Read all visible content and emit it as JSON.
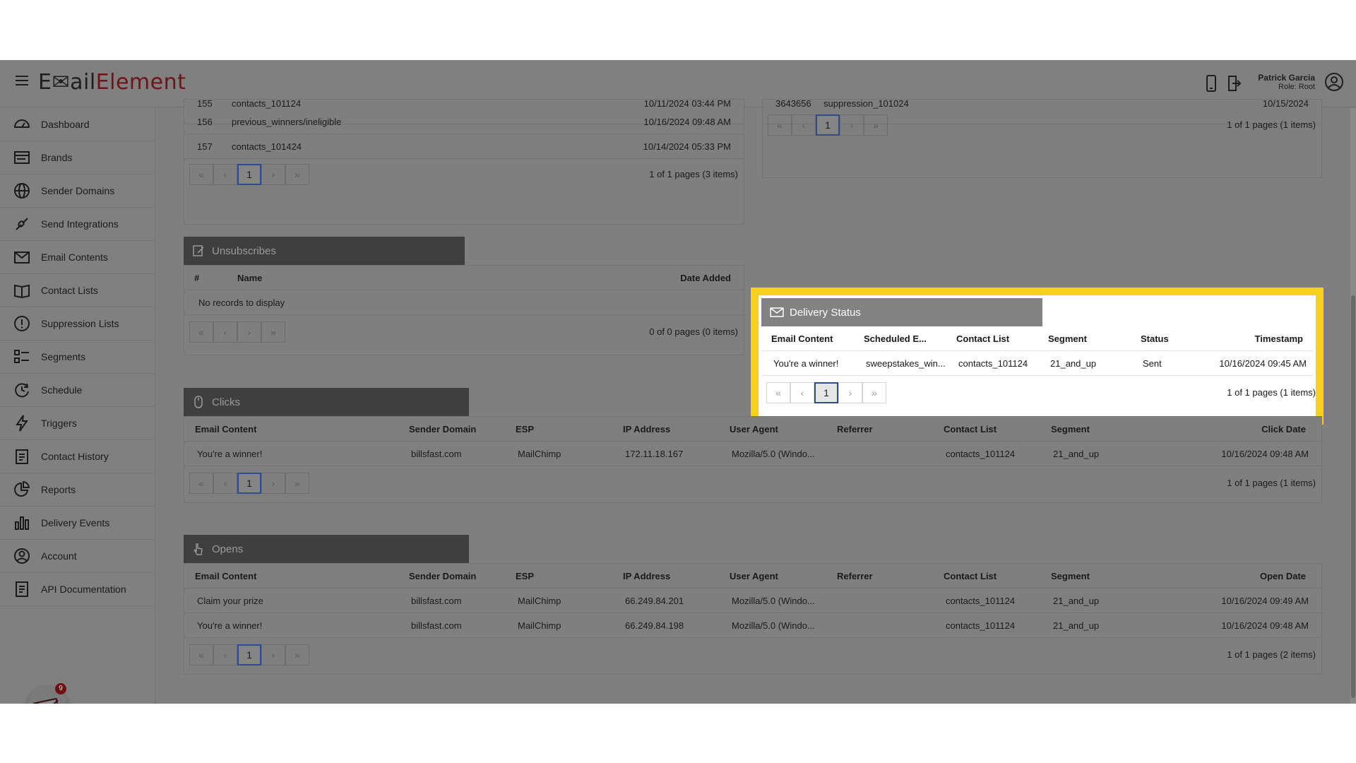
{
  "app": {
    "logo_e": "E",
    "logo_mail": "✉ail",
    "logo_element": "Element"
  },
  "user": {
    "name": "Patrick Garcia",
    "role": "Role: Root"
  },
  "sidebar": {
    "items": [
      {
        "label": "Dashboard",
        "icon": "dashboard-icon"
      },
      {
        "label": "Brands",
        "icon": "brands-icon"
      },
      {
        "label": "Sender Domains",
        "icon": "globe-icon"
      },
      {
        "label": "Send Integrations",
        "icon": "link-icon"
      },
      {
        "label": "Email Contents",
        "icon": "envelope-icon"
      },
      {
        "label": "Contact Lists",
        "icon": "book-icon"
      },
      {
        "label": "Suppression Lists",
        "icon": "alert-icon"
      },
      {
        "label": "Segments",
        "icon": "segments-icon"
      },
      {
        "label": "Schedule",
        "icon": "clock-icon"
      },
      {
        "label": "Triggers",
        "icon": "bolt-icon"
      },
      {
        "label": "Contact History",
        "icon": "clipboard-icon"
      },
      {
        "label": "Reports",
        "icon": "pie-icon"
      },
      {
        "label": "Delivery Events",
        "icon": "bar-chart-icon"
      },
      {
        "label": "Account",
        "icon": "user-icon"
      },
      {
        "label": "API Documentation",
        "icon": "document-icon"
      }
    ],
    "notification_count": "9"
  },
  "contact_lists_partial": {
    "rows": [
      {
        "id": "155",
        "name": "contacts_101124",
        "date": "10/11/2024 03:44 PM"
      },
      {
        "id": "156",
        "name": "previous_winners/ineligible",
        "date": "10/16/2024 09:48 AM"
      },
      {
        "id": "157",
        "name": "contacts_101424",
        "date": "10/14/2024 05:33 PM"
      }
    ],
    "page": "1",
    "info": "1 of 1 pages (3 items)"
  },
  "suppression_partial": {
    "row": {
      "id": "3643656",
      "name": "suppression_101024",
      "date": "10/15/2024"
    },
    "page": "1",
    "info": "1 of 1 pages (1 items)"
  },
  "unsubscribes": {
    "title": "Unsubscribes",
    "headers": {
      "num": "#",
      "name": "Name",
      "date": "Date Added"
    },
    "empty": "No records to display",
    "page": "",
    "info": "0 of 0 pages (0 items)"
  },
  "delivery_status": {
    "title": "Delivery Status",
    "headers": {
      "email": "Email Content",
      "scheduled": "Scheduled E...",
      "list": "Contact List",
      "segment": "Segment",
      "status": "Status",
      "timestamp": "Timestamp"
    },
    "row": {
      "email": "You're a winner!",
      "scheduled": "sweepstakes_win...",
      "list": "contacts_101124",
      "segment": "21_and_up",
      "status": "Sent",
      "timestamp": "10/16/2024 09:45 AM"
    },
    "page": "1",
    "info": "1 of 1 pages (1 items)"
  },
  "clicks": {
    "title": "Clicks",
    "headers": {
      "email": "Email Content",
      "domain": "Sender Domain",
      "esp": "ESP",
      "ip": "IP Address",
      "agent": "User Agent",
      "ref": "Referrer",
      "list": "Contact List",
      "segment": "Segment",
      "date": "Click Date"
    },
    "rows": [
      {
        "email": "You're a winner!",
        "domain": "billsfast.com",
        "esp": "MailChimp",
        "ip": "172.11.18.167",
        "agent": "Mozilla/5.0 (Windo...",
        "ref": "",
        "list": "contacts_101124",
        "segment": "21_and_up",
        "date": "10/16/2024 09:48 AM"
      }
    ],
    "page": "1",
    "info": "1 of 1 pages (1 items)"
  },
  "opens": {
    "title": "Opens",
    "headers": {
      "email": "Email Content",
      "domain": "Sender Domain",
      "esp": "ESP",
      "ip": "IP Address",
      "agent": "User Agent",
      "ref": "Referrer",
      "list": "Contact List",
      "segment": "Segment",
      "date": "Open Date"
    },
    "rows": [
      {
        "email": "Claim your prize",
        "domain": "billsfast.com",
        "esp": "MailChimp",
        "ip": "66.249.84.201",
        "agent": "Mozilla/5.0 (Windo...",
        "ref": "",
        "list": "contacts_101124",
        "segment": "21_and_up",
        "date": "10/16/2024 09:49 AM"
      },
      {
        "email": "You're a winner!",
        "domain": "billsfast.com",
        "esp": "MailChimp",
        "ip": "66.249.84.198",
        "agent": "Mozilla/5.0 (Windo...",
        "ref": "",
        "list": "contacts_101124",
        "segment": "21_and_up",
        "date": "10/16/2024 09:48 AM"
      }
    ],
    "page": "1",
    "info": "1 of 1 pages (2 items)"
  },
  "pager_glyphs": {
    "first": "«",
    "prev": "‹",
    "next": "›",
    "last": "»"
  },
  "colors": {
    "highlight": "#f7d01c",
    "brand_red": "#6f1418",
    "page_active": "#2e4c8e"
  }
}
